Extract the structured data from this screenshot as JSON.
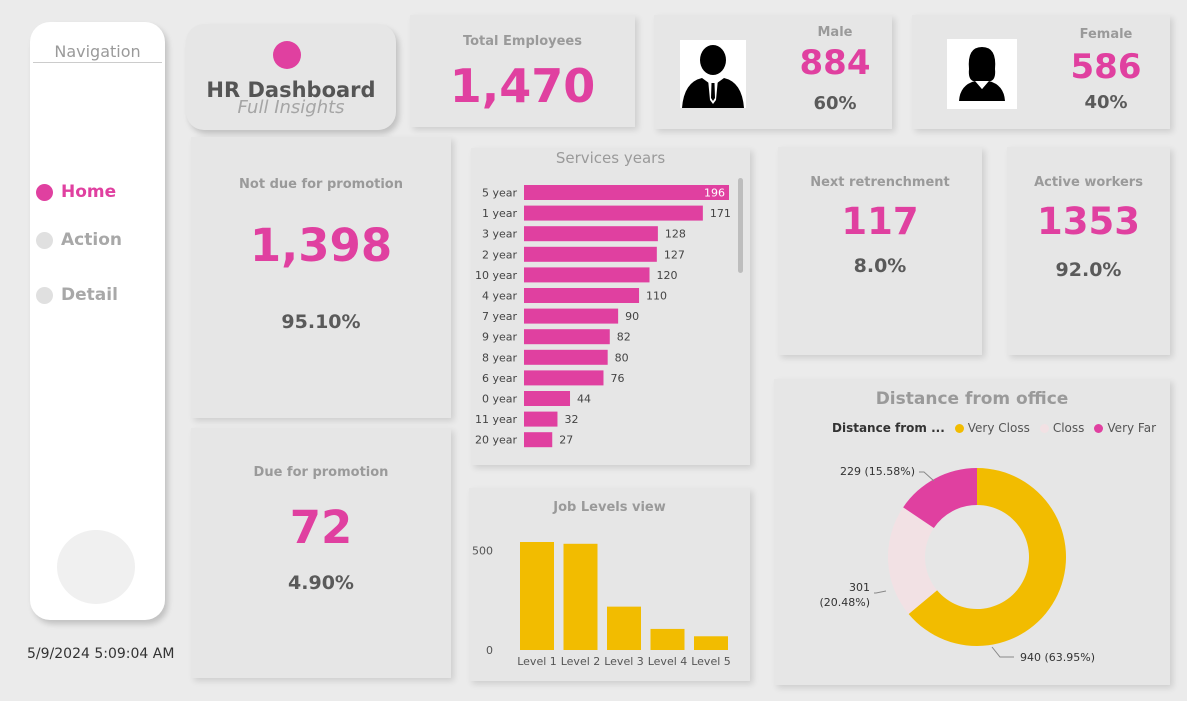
{
  "nav": {
    "title": "Navigation",
    "items": [
      {
        "label": "Home",
        "active": true
      },
      {
        "label": "Action",
        "active": false
      },
      {
        "label": "Detail",
        "active": false
      }
    ],
    "datetime": "5/9/2024 5:09:04 AM"
  },
  "header": {
    "title": "HR Dashboard",
    "subtitle": "Full Insights"
  },
  "kpis": {
    "total": {
      "label": "Total Employees",
      "value": "1,470"
    },
    "male": {
      "label": "Male",
      "value": "884",
      "pct": "60%"
    },
    "female": {
      "label": "Female",
      "value": "586",
      "pct": "40%"
    },
    "not_due": {
      "label": "Not due for promotion",
      "value": "1,398",
      "pct": "95.10%"
    },
    "due": {
      "label": "Due for promotion",
      "value": "72",
      "pct": "4.90%"
    },
    "retrench": {
      "label": "Next retrenchment",
      "value": "117",
      "pct": "8.0%"
    },
    "active": {
      "label": "Active workers",
      "value": "1353",
      "pct": "92.0%"
    }
  },
  "colors": {
    "accent": "#e040a0",
    "gold": "#f2bc00",
    "pale": "#f2e1e4"
  },
  "chart_data": [
    {
      "type": "bar",
      "orientation": "horizontal",
      "title": "Services years",
      "categories": [
        "5 year",
        "1 year",
        "3 year",
        "2 year",
        "10 year",
        "4 year",
        "7 year",
        "9 year",
        "8 year",
        "6 year",
        "0 year",
        "11 year",
        "20 year"
      ],
      "values": [
        196,
        171,
        128,
        127,
        120,
        110,
        90,
        82,
        80,
        76,
        44,
        32,
        27
      ]
    },
    {
      "type": "bar",
      "title": "Job Levels view",
      "categories": [
        "Level 1",
        "Level 2",
        "Level 3",
        "Level 4",
        "Level 5"
      ],
      "values": [
        543,
        534,
        218,
        106,
        69
      ],
      "yticks": [
        "500",
        "0"
      ]
    },
    {
      "type": "pie",
      "title": "Distance from office",
      "legend_title": "Distance from ...",
      "series": [
        {
          "name": "Very Closs",
          "value": 940,
          "label": "940 (63.95%)"
        },
        {
          "name": "Closs",
          "value": 301,
          "label": "301 (20.48%)"
        },
        {
          "name": "Very Far",
          "value": 229,
          "label": "229 (15.58%)"
        }
      ]
    }
  ]
}
